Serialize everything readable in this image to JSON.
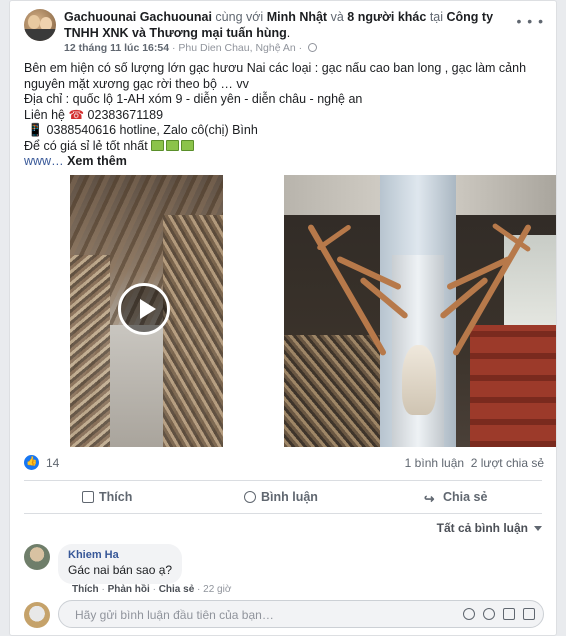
{
  "post": {
    "author": "Gachuounai Gachuounai",
    "with_text": " cùng với ",
    "tag1": "Minh Nhật",
    "and_text": " và ",
    "tag2": "8 người khác",
    "at_text": " tại ",
    "place": "Công ty TNHH XNK và Thương mại tuấn hùng",
    "place_end": ".",
    "time": "12 tháng 11 lúc 16:54",
    "location": " · Phu Dien Chau, Nghệ An · ",
    "more": "• • •",
    "lines": [
      "Bên em hiện có số lượng lớn gạc hươu Nai các loại : gạc nấu cao ban long , gạc làm cảnh",
      "nguyên mặt xương gạc rời theo bộ … vv",
      "Địa chỉ : quốc lộ 1-AH xóm 9 - diễn yên - diễn châu - nghệ an"
    ],
    "contact_label": "Liên hệ ",
    "phone_icon": "☎",
    "phone": " 02383671189",
    "hotline_icon": "📱",
    "hotline": " 0388540616 hotline, Zalo cô(chị) Bình",
    "price_line": "Để có giá sỉ lẻ tốt nhất ",
    "link_prefix": "www… ",
    "see_more": "Xem thêm"
  },
  "reactions": {
    "like_count": "14",
    "comments": "1 bình luận",
    "shares": "2 lượt chia sẻ"
  },
  "actions": {
    "like": "Thích",
    "comment": "Bình luận",
    "share": "Chia sẻ"
  },
  "sort_label": "Tất cả bình luận",
  "comment": {
    "author": "Khiem Ha",
    "text": "Gác nai bán sao ạ?",
    "like": "Thích",
    "reply": "Phản hồi",
    "share": "Chia sẻ",
    "time": "22 giờ",
    "sep": " · "
  },
  "reply_box": {
    "placeholder": "Hãy gửi bình luận đầu tiên của bạn…"
  }
}
